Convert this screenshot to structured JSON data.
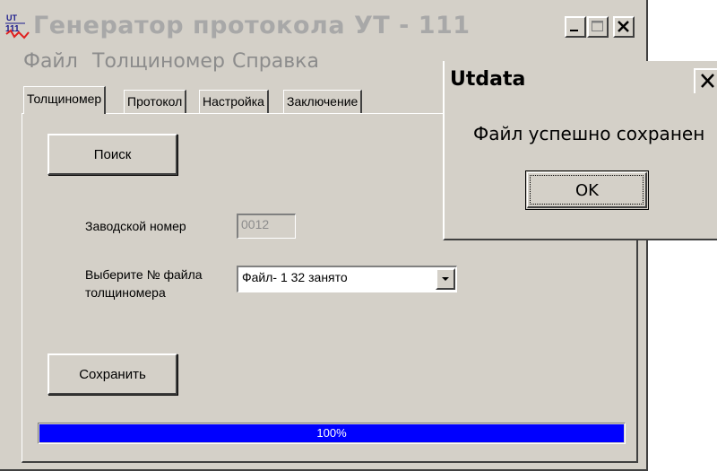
{
  "window": {
    "title": "Генератор протокола УТ - 111",
    "icon": "app-ut111-icon",
    "icon_text_top": "UT",
    "icon_text_bottom": "111"
  },
  "menu": [
    "Файл",
    "Толщиномер",
    "Справка"
  ],
  "tabs": [
    {
      "label": "Толщиномер",
      "active": true
    },
    {
      "label": "Протокол",
      "active": false
    },
    {
      "label": "Настройка",
      "active": false
    },
    {
      "label": "Заключение",
      "active": false
    }
  ],
  "panel": {
    "search_button": "Поиск",
    "serial_label": "Заводской номер",
    "serial_value": "0012",
    "file_label_line1": "Выберите № файла",
    "file_label_line2": "толщиномера",
    "file_select_value": "Файл- 1  32  занято",
    "save_button": "Сохранить",
    "progress_text": "100%",
    "progress_value": 1.0
  },
  "dialog": {
    "title": "Utdata",
    "message": "Файл успешно сохранен",
    "ok_button": "OK"
  },
  "colors": {
    "window_bg": "#d4d0c8",
    "title_inactive_text": "#a8a8a8",
    "progress_fill": "#0000ff"
  }
}
